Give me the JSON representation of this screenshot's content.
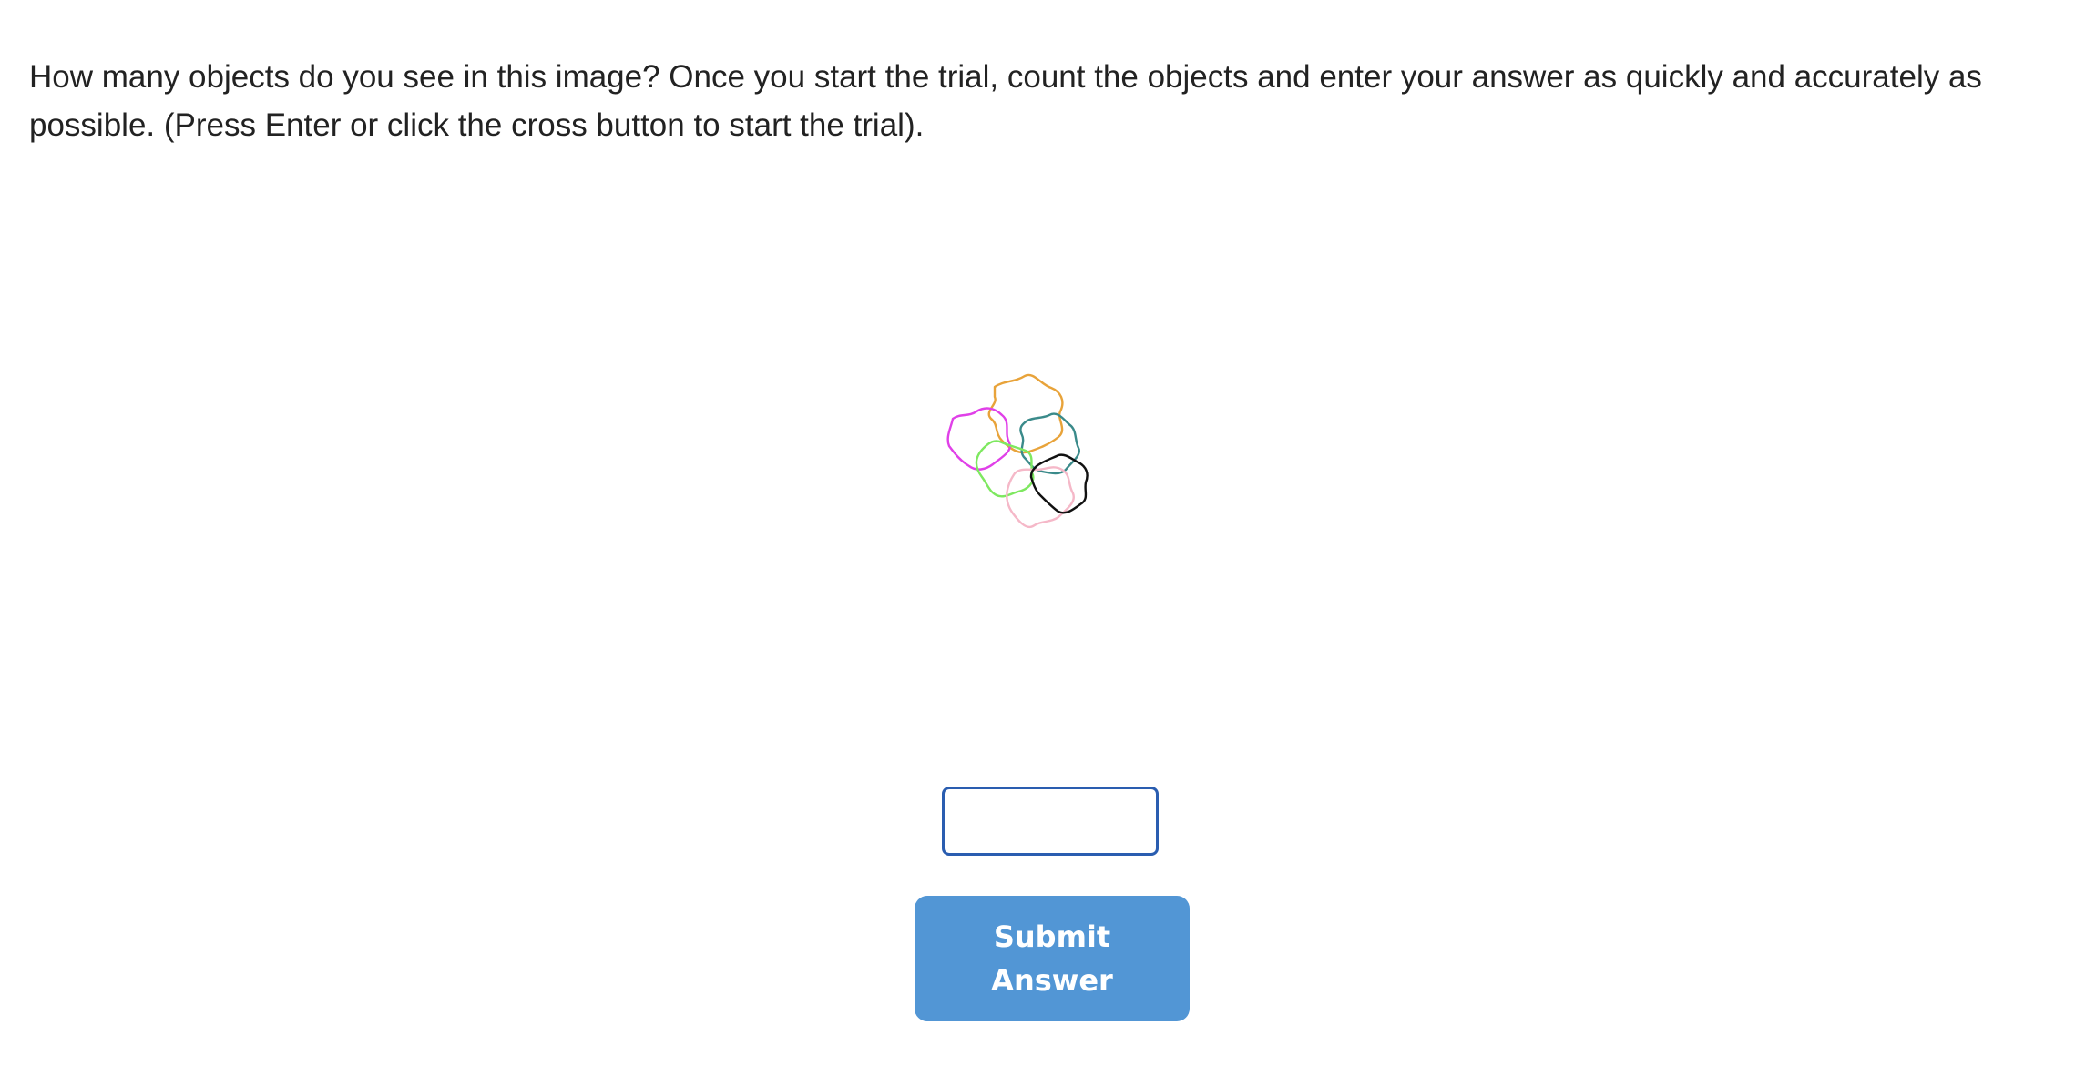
{
  "instructions": "How many objects do you see in this image? Once you start the trial, count the objects and enter your answer as quickly and accurately as possible. (Press Enter or click the cross button to start the trial).",
  "answer": {
    "value": "",
    "placeholder": ""
  },
  "submit": {
    "line1": "Submit",
    "line2": "Answer"
  },
  "stimulus": {
    "object_count": 6,
    "colors": [
      "#e8a33a",
      "#e040e8",
      "#3a8a8a",
      "#7ee860",
      "#111111",
      "#f5b8c8"
    ]
  }
}
